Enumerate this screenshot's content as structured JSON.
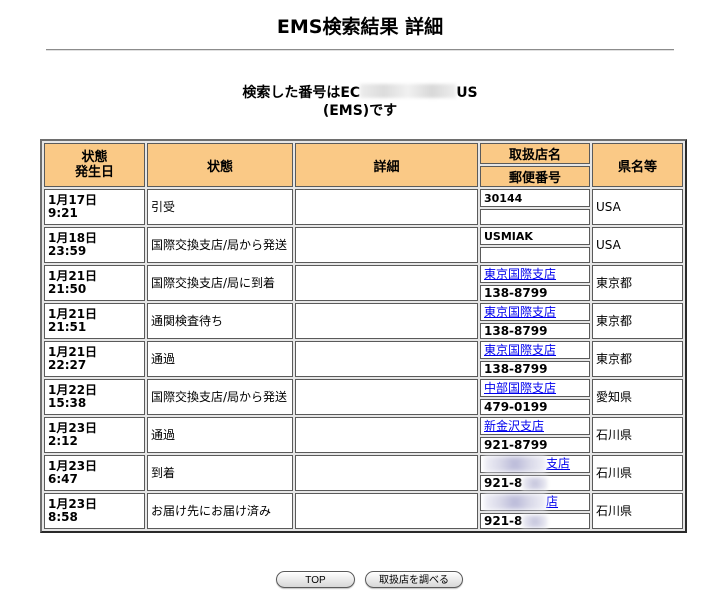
{
  "page": {
    "title": "EMS検索結果 詳細",
    "subtitle_prefix": "検索した番号はEC",
    "subtitle_suffix": "US",
    "subtitle_line2": "(EMS)です"
  },
  "table": {
    "headers": {
      "date": "状態\n発生日",
      "status": "状態",
      "detail": "詳細",
      "office": "取扱店名",
      "zip": "郵便番号",
      "pref": "県名等"
    },
    "rows": [
      {
        "date": "1月17日\n9:21",
        "status": "引受",
        "detail": "",
        "office": "30144",
        "zip": "",
        "pref": "USA",
        "link": false,
        "blur": false
      },
      {
        "date": "1月18日\n23:59",
        "status": "国際交換支店/局から発送",
        "detail": "",
        "office": "USMIAK",
        "zip": "",
        "pref": "USA",
        "link": false,
        "blur": false
      },
      {
        "date": "1月21日\n21:50",
        "status": "国際交換支店/局に到着",
        "detail": "",
        "office": "東京国際支店",
        "zip": "138-8799",
        "pref": "東京都",
        "link": true,
        "blur": false
      },
      {
        "date": "1月21日\n21:51",
        "status": "通関検査待ち",
        "detail": "",
        "office": "東京国際支店",
        "zip": "138-8799",
        "pref": "東京都",
        "link": true,
        "blur": false
      },
      {
        "date": "1月21日\n22:27",
        "status": "通過",
        "detail": "",
        "office": "東京国際支店",
        "zip": "138-8799",
        "pref": "東京都",
        "link": true,
        "blur": false
      },
      {
        "date": "1月22日\n15:38",
        "status": "国際交換支店/局から発送",
        "detail": "",
        "office": "中部国際支店",
        "zip": "479-0199",
        "pref": "愛知県",
        "link": true,
        "blur": false
      },
      {
        "date": "1月23日\n2:12",
        "status": "通過",
        "detail": "",
        "office": "新金沢支店",
        "zip": "921-8799",
        "pref": "石川県",
        "link": true,
        "blur": false
      },
      {
        "date": "1月23日\n6:47",
        "status": "到着",
        "detail": "",
        "office": "支店",
        "zip": "921-8",
        "pref": "石川県",
        "link": true,
        "blur": true
      },
      {
        "date": "1月23日\n8:58",
        "status": "お届け先にお届け済み",
        "detail": "",
        "office": "店",
        "zip": "921-8",
        "pref": "石川県",
        "link": true,
        "blur": true
      }
    ]
  },
  "buttons": {
    "top": "TOP",
    "office": "取扱店を調べる"
  }
}
